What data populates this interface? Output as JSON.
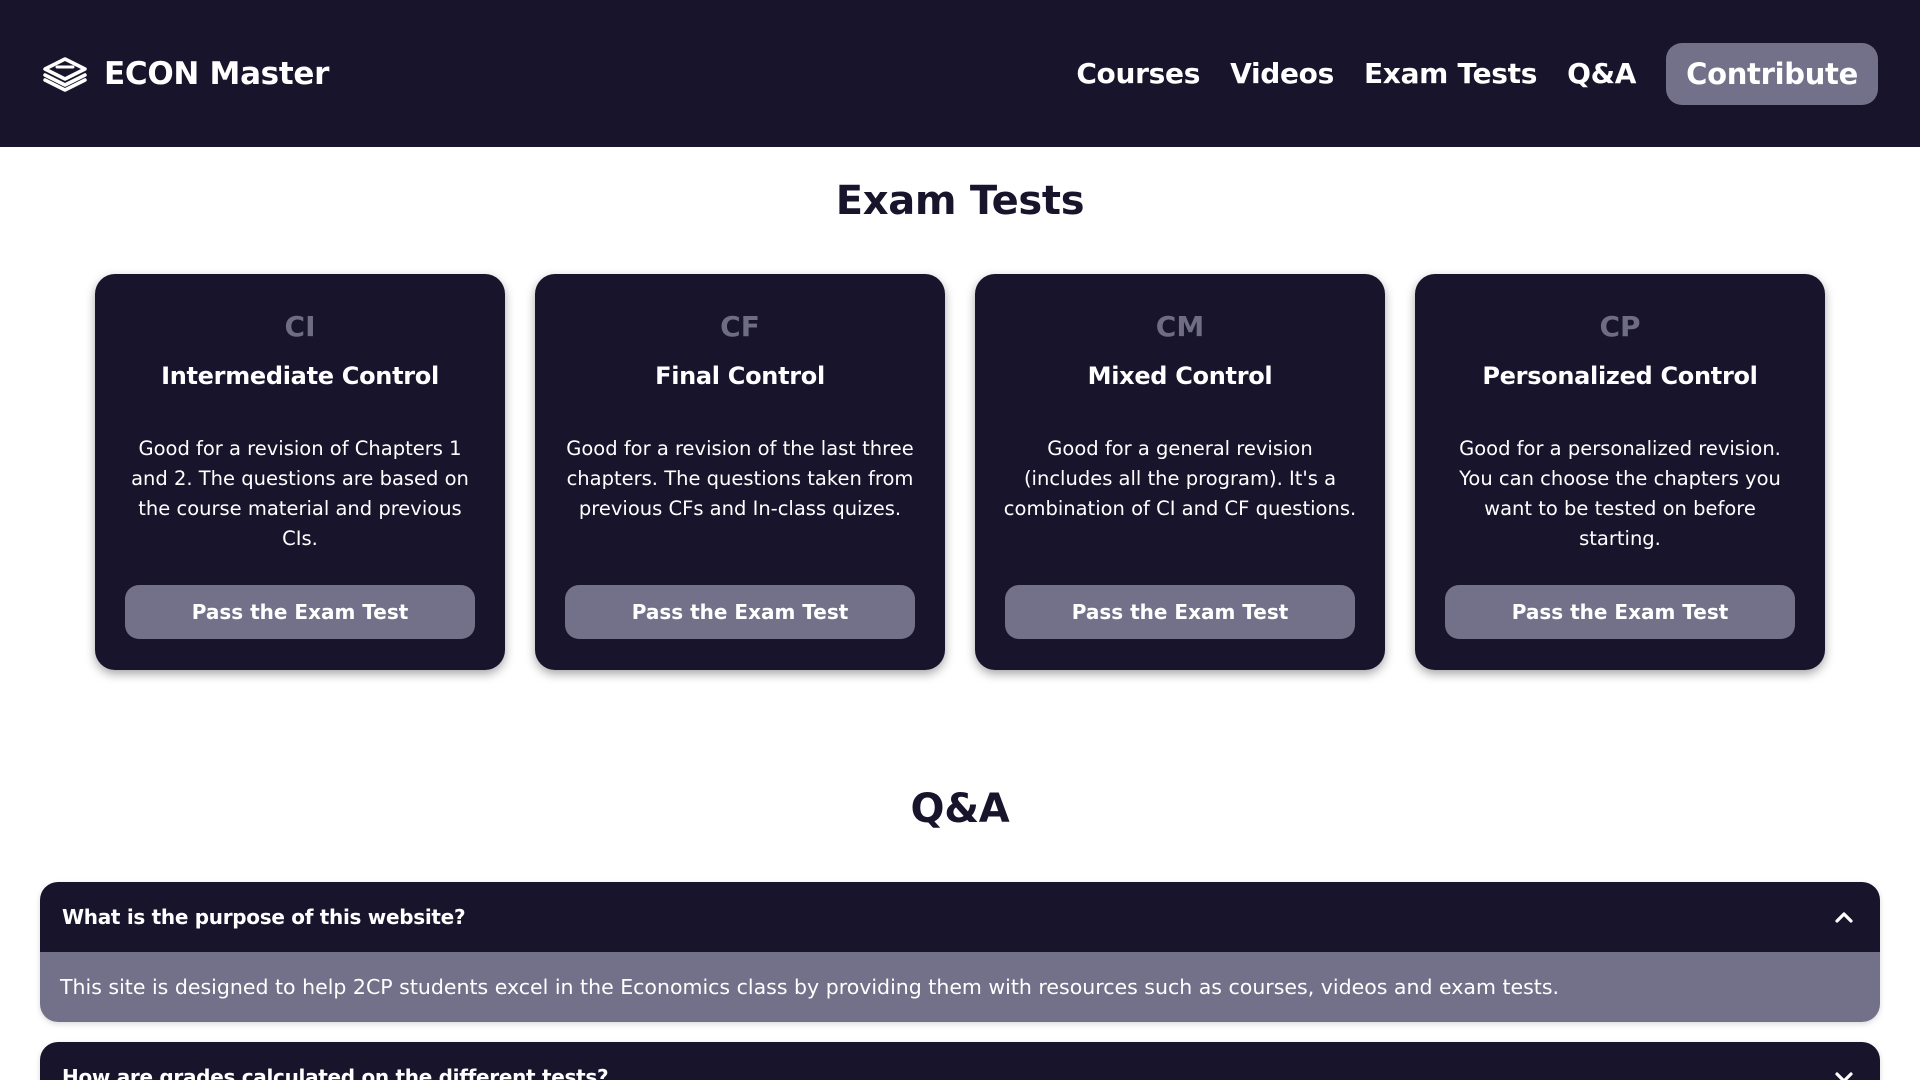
{
  "brand": {
    "name": "ECON Master",
    "logo_icon": "layers-icon"
  },
  "nav": {
    "links": [
      "Courses",
      "Videos",
      "Exam Tests",
      "Q&A"
    ],
    "cta": "Contribute"
  },
  "exam_section": {
    "title": "Exam Tests",
    "cards": [
      {
        "code": "CI",
        "name": "Intermediate Control",
        "description": "Good for a revision of Chapters 1 and 2. The questions are based on the course material and previous CIs.",
        "button": "Pass the Exam Test"
      },
      {
        "code": "CF",
        "name": "Final Control",
        "description": "Good for a revision of the last three chapters. The questions taken from previous CFs and In-class quizes.",
        "button": "Pass the Exam Test"
      },
      {
        "code": "CM",
        "name": "Mixed Control",
        "description": "Good for a general revision (includes all the program). It's a combination of CI and CF questions.",
        "button": "Pass the Exam Test"
      },
      {
        "code": "CP",
        "name": "Personalized Control",
        "description": "Good for a personalized revision. You can choose the chapters you want to be tested on before starting.",
        "button": "Pass the Exam Test"
      }
    ]
  },
  "qa_section": {
    "title": "Q&A",
    "items": [
      {
        "question": "What is the purpose of this website?",
        "answer": "This site is designed to help 2CP students excel in the Economics class by providing them with resources such as courses, videos and exam tests.",
        "expanded": true,
        "icon": "chevron-up-icon"
      },
      {
        "question": "How are grades calculated on the different tests?",
        "expanded": false,
        "icon": "chevron-down-icon"
      }
    ]
  },
  "colors": {
    "primary_dark": "#17142b",
    "accent_gray": "#737089",
    "code_gray": "#6f6c85",
    "background": "#ffffff"
  }
}
